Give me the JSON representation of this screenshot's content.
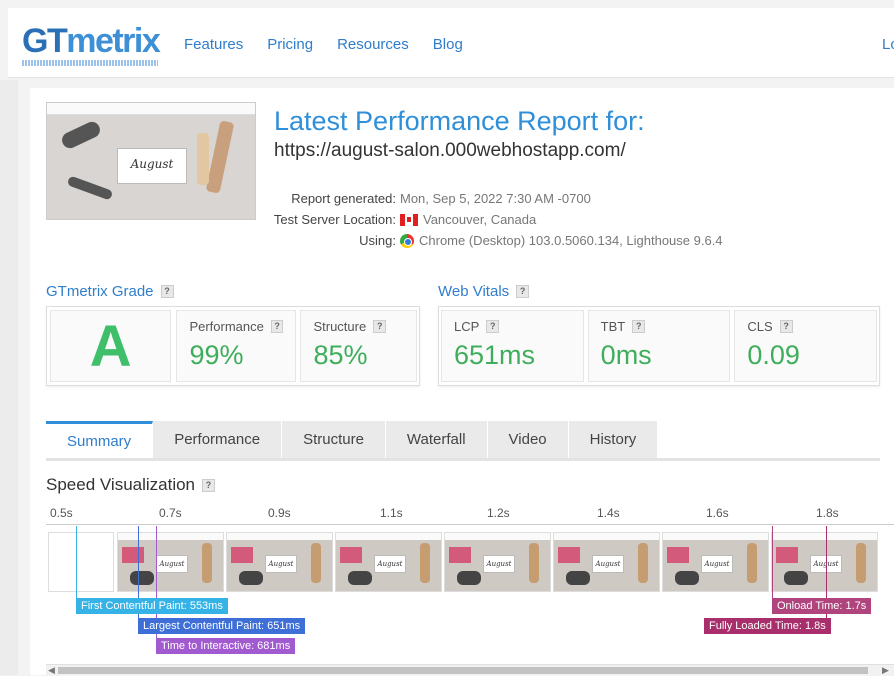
{
  "header": {
    "logo_bold": "GT",
    "logo_rest": "metrix",
    "nav": [
      "Features",
      "Pricing",
      "Resources",
      "Blog"
    ],
    "login": "Lo"
  },
  "report": {
    "thumbnail_text": "August",
    "title": "Latest Performance Report for:",
    "url": "https://august-salon.000webhostapp.com/",
    "generated_label": "Report generated:",
    "generated_value": "Mon, Sep 5, 2022 7:30 AM -0700",
    "location_label": "Test Server Location:",
    "location_value": "Vancouver, Canada",
    "using_label": "Using:",
    "using_value": "Chrome (Desktop) 103.0.5060.134, Lighthouse 9.6.4"
  },
  "grade": {
    "title": "GTmetrix Grade",
    "letter": "A",
    "performance_label": "Performance",
    "performance_value": "99%",
    "structure_label": "Structure",
    "structure_value": "85%"
  },
  "vitals": {
    "title": "Web Vitals",
    "lcp_label": "LCP",
    "lcp_value": "651ms",
    "tbt_label": "TBT",
    "tbt_value": "0ms",
    "cls_label": "CLS",
    "cls_value": "0.09"
  },
  "tabs": [
    "Summary",
    "Performance",
    "Structure",
    "Waterfall",
    "Video",
    "History"
  ],
  "speed": {
    "title": "Speed Visualization",
    "ticks": [
      "0.5s",
      "0.7s",
      "0.9s",
      "1.1s",
      "1.2s",
      "1.4s",
      "1.6s",
      "1.8s"
    ],
    "frame_text": "August",
    "events": {
      "fcp": "First Contentful Paint: 553ms",
      "lcp": "Largest Contentful Paint: 651ms",
      "tti": "Time to Interactive: 681ms",
      "onload": "Onload Time: 1.7s",
      "fully_loaded": "Fully Loaded Time: 1.8s"
    }
  },
  "colors": {
    "brand_blue": "#2f8fd8",
    "grade_green": "#3fbf6a",
    "fcp": "#35b3e6",
    "lcp": "#3d6fd6",
    "tti": "#a25ad0",
    "onload": "#b0457e",
    "fully_loaded": "#a82f6b"
  }
}
